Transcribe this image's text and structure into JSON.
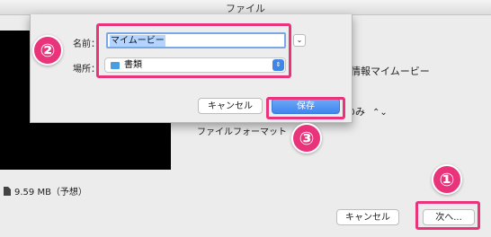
{
  "window": {
    "title": "ファイル"
  },
  "export": {
    "filesize": "9.59 MB（予想）",
    "info_text": "の情報マイムービー",
    "only_text": "のみ",
    "only_arrow": "⌃⌄",
    "format_label": "ファイルフォーマット",
    "cancel_label": "キャンセル",
    "next_label": "次へ..."
  },
  "save_sheet": {
    "name_label": "名前：",
    "name_value": "マイムービー",
    "place_label": "場所：",
    "place_value": "書類",
    "expand_glyph": "⌄",
    "stepper_glyph": "⇕",
    "cancel_label": "キャンセル",
    "save_label": "保存"
  },
  "annotations": {
    "step1": "①",
    "step2": "②",
    "step3": "③",
    "color": "#e9347b"
  }
}
